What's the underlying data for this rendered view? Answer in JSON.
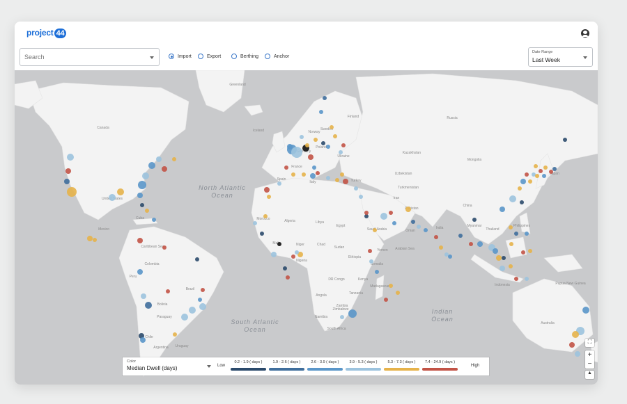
{
  "logo": {
    "text": "project",
    "badge": "44"
  },
  "search": {
    "placeholder": "Search"
  },
  "direction": {
    "options": [
      {
        "label": "Import",
        "selected": true
      },
      {
        "label": "Export",
        "selected": false
      },
      {
        "label": "Berthing",
        "selected": false
      },
      {
        "label": "Anchor",
        "selected": false
      }
    ]
  },
  "date_range": {
    "label": "Date Range",
    "value": "Last Week"
  },
  "map": {
    "countries": [
      "Canada",
      "United States",
      "Mexico",
      "Cuba",
      "Caribbean Sea",
      "Colombia",
      "Peru",
      "Brazil",
      "Bolivia",
      "Paraguay",
      "Chile",
      "Argentina",
      "Uruguay",
      "Greenland",
      "Iceland",
      "Norway",
      "Sweden",
      "Finland",
      "Poland",
      "Ukraine",
      "Germany",
      "France",
      "Spain",
      "Italy",
      "Turkey",
      "Kazakhstan",
      "Uzbekistan",
      "Turkmenistan",
      "Iran",
      "Russia",
      "Mongolia",
      "China",
      "Japan",
      "India",
      "Pakistan",
      "Arabian Sea",
      "Morocco",
      "Algeria",
      "Libya",
      "Egypt",
      "Mali",
      "Niger",
      "Nigeria",
      "Chad",
      "Sudan",
      "Ethiopia",
      "Somalia",
      "Kenya",
      "Tanzania",
      "DR Congo",
      "Angola",
      "Zambia",
      "Zimbabwe",
      "Namibia",
      "South Africa",
      "Madagascar",
      "Saudi Arabia",
      "Yemen",
      "Oman",
      "Thailand",
      "Myanmar",
      "Indonesia",
      "Philippines",
      "Papua New Guinea",
      "Australia"
    ],
    "oceans": [
      "North Atlantic Ocean",
      "South Atlantic Ocean",
      "Indian Ocean"
    ],
    "dot_colors": [
      "#2b4a6b",
      "#3f6e9c",
      "#5a96c9",
      "#9cc3de",
      "#e6b24a",
      "#c25346",
      "#111111"
    ]
  },
  "legend": {
    "color_label": "Color",
    "color_value": "Median Dwell (days)",
    "low": "Low",
    "high": "High",
    "bins": [
      {
        "label": "0.2 - 1.9 ( days )",
        "color": "#2b4a6b"
      },
      {
        "label": "1.9 - 2.6 ( days )",
        "color": "#3f6e9c"
      },
      {
        "label": "2.6 - 3.9 ( days )",
        "color": "#5a96c9"
      },
      {
        "label": "3.9 - 5.3 ( days )",
        "color": "#9cc3de"
      },
      {
        "label": "5.3 - 7.3 ( days )",
        "color": "#e6b24a"
      },
      {
        "label": "7.4 - 24.9 ( days )",
        "color": "#c25346"
      }
    ]
  },
  "zoom": {
    "in": "+",
    "out": "−"
  }
}
